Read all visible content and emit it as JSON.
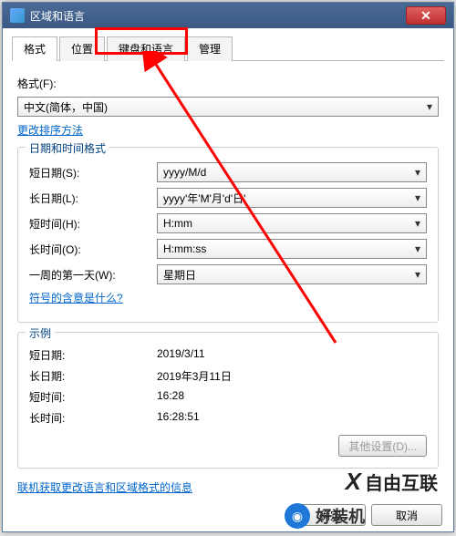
{
  "window": {
    "title": "区域和语言"
  },
  "tabs": {
    "t0": "格式",
    "t1": "位置",
    "t2": "键盘和语言",
    "t3": "管理"
  },
  "format": {
    "label": "格式(F):",
    "value": "中文(简体，中国)",
    "sort_link": "更改排序方法"
  },
  "datetime": {
    "group_title": "日期和时间格式",
    "short_date_label": "短日期(S):",
    "short_date_value": "yyyy/M/d",
    "long_date_label": "长日期(L):",
    "long_date_value": "yyyy'年'M'月'd'日'",
    "short_time_label": "短时间(H):",
    "short_time_value": "H:mm",
    "long_time_label": "长时间(O):",
    "long_time_value": "H:mm:ss",
    "first_day_label": "一周的第一天(W):",
    "first_day_value": "星期日",
    "symbol_link": "符号的含意是什么?"
  },
  "example": {
    "group_title": "示例",
    "short_date_label": "短日期:",
    "short_date_value": "2019/3/11",
    "long_date_label": "长日期:",
    "long_date_value": "2019年3月11日",
    "short_time_label": "短时间:",
    "short_time_value": "16:28",
    "long_time_label": "长时间:",
    "long_time_value": "16:28:51"
  },
  "buttons": {
    "other_settings": "其他设置(D)...",
    "online_link": "联机获取更改语言和区域格式的信息",
    "ok": "确定",
    "cancel": "取消"
  },
  "watermarks": {
    "w1": "自由互联",
    "w2": "好装机"
  }
}
